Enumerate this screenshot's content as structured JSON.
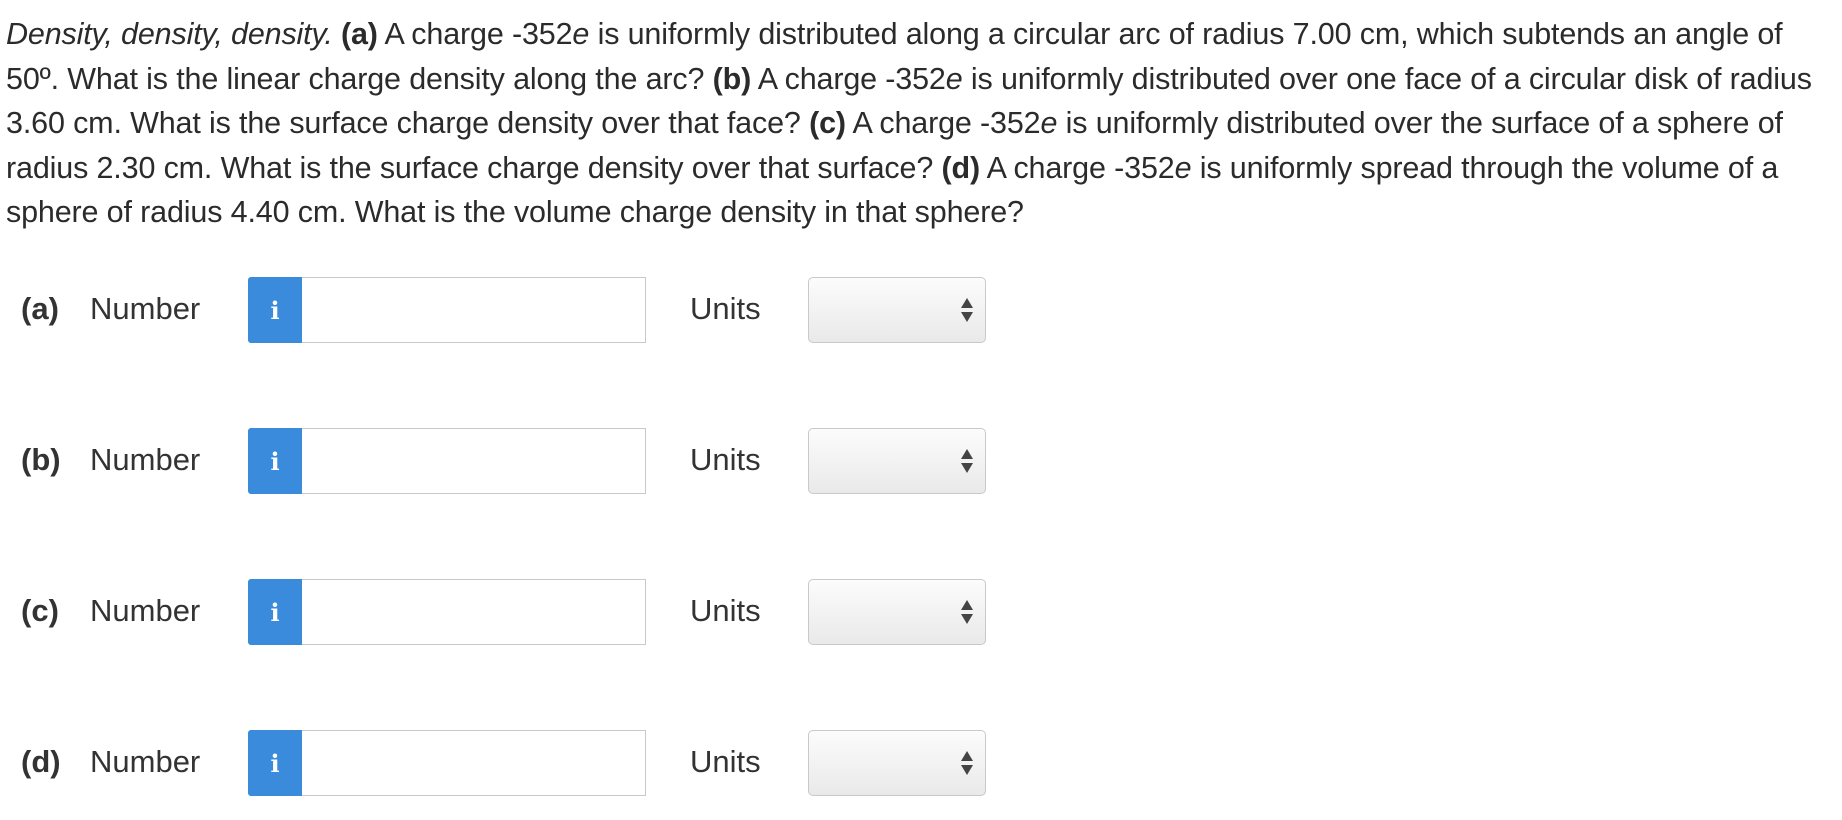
{
  "question": {
    "title": "Density, density, density.",
    "parts": [
      {
        "tag": "(a)",
        "pre": " A charge -352",
        "e": "e",
        "post": " is uniformly distributed along a circular arc of radius 7.00 cm, which subtends an angle of 50º. What is the linear charge density along the arc? "
      },
      {
        "tag": "(b)",
        "pre": " A charge -352",
        "e": "e",
        "post": " is uniformly distributed over one face of a circular disk of radius 3.60 cm. What is the surface charge density over that face? "
      },
      {
        "tag": "(c)",
        "pre": " A charge -352",
        "e": "e",
        "post": " is uniformly distributed over the surface of a sphere of radius 2.30 cm. What is the surface charge density over that surface? "
      },
      {
        "tag": "(d)",
        "pre": " A charge -352",
        "e": "e",
        "post": " is uniformly spread through the volume of a sphere of radius 4.40 cm. What is the volume charge density in that sphere?"
      }
    ]
  },
  "answers": [
    {
      "part": "(a)",
      "number_label": "Number",
      "info_icon": "i",
      "value": "",
      "units_label": "Units",
      "units_selected": ""
    },
    {
      "part": "(b)",
      "number_label": "Number",
      "info_icon": "i",
      "value": "",
      "units_label": "Units",
      "units_selected": ""
    },
    {
      "part": "(c)",
      "number_label": "Number",
      "info_icon": "i",
      "value": "",
      "units_label": "Units",
      "units_selected": ""
    },
    {
      "part": "(d)",
      "number_label": "Number",
      "info_icon": "i",
      "value": "",
      "units_label": "Units",
      "units_selected": ""
    }
  ],
  "colors": {
    "info_button": "#3a8bdb",
    "text": "#2b2b2b",
    "border": "#c9c9c9"
  }
}
